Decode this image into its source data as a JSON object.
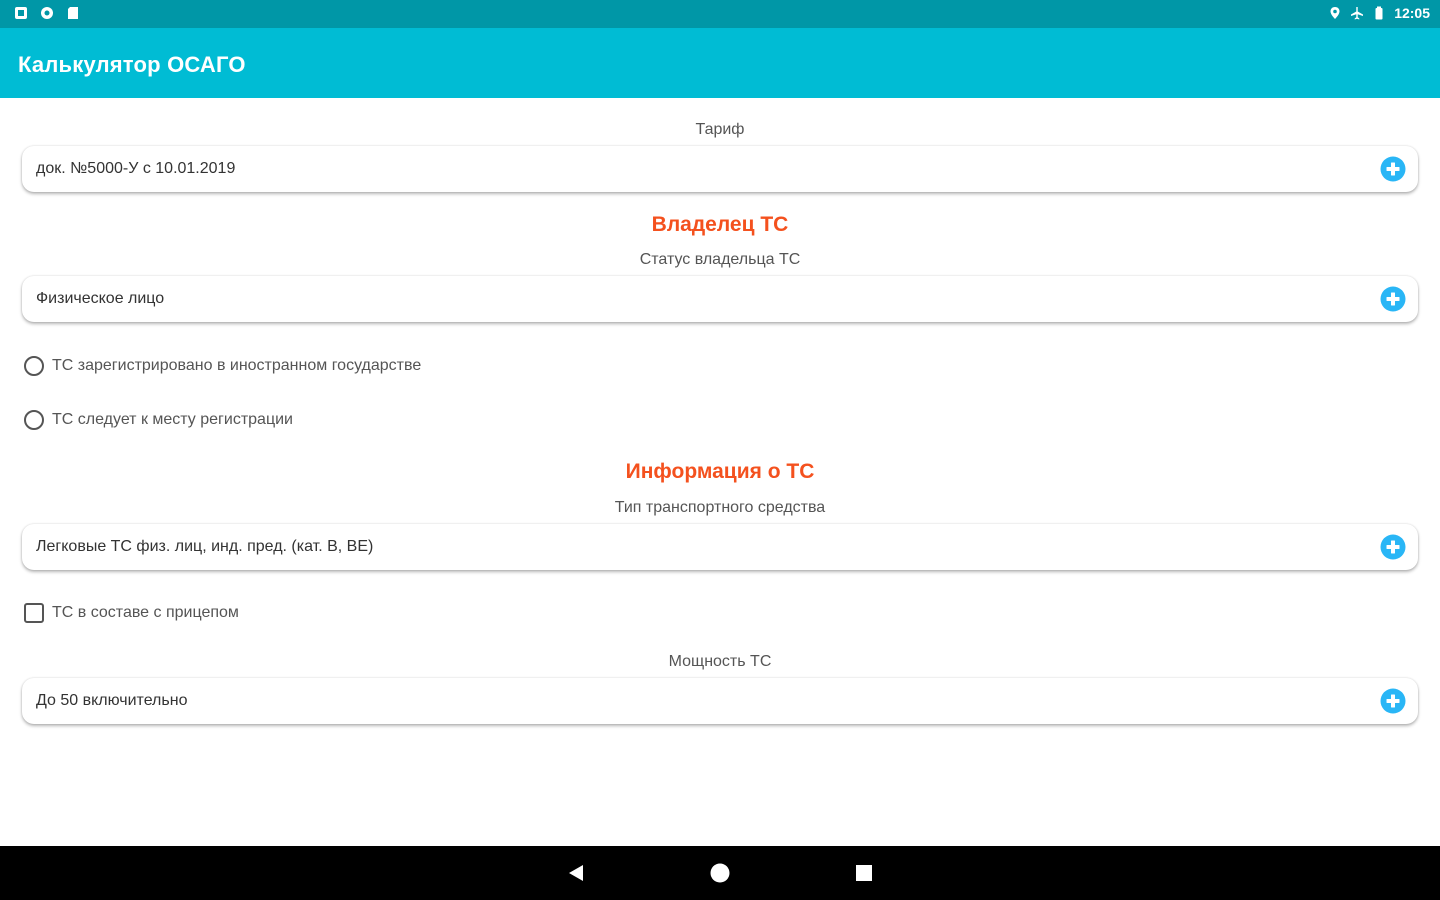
{
  "status_bar": {
    "left_icons": [
      "notification-icon",
      "settings-circle-icon",
      "sd-card-icon"
    ],
    "right_icons": [
      "location-icon",
      "airplane-icon",
      "battery-icon"
    ],
    "time": "12:05"
  },
  "app_bar": {
    "title": "Калькулятор ОСАГО"
  },
  "tariff": {
    "label": "Тариф",
    "value": "док. №5000-У с 10.01.2019"
  },
  "owner_section": {
    "title": "Владелец ТС",
    "status_label": "Статус владельца ТС",
    "status_value": "Физическое лицо",
    "option_foreign": "ТС зарегистрировано в иностранном государстве",
    "option_to_registration": "ТС следует к месту регистрации"
  },
  "vehicle_section": {
    "title": "Информация о ТС",
    "type_label": "Тип транспортного средства",
    "type_value": "Легковые ТС физ. лиц, инд. пред. (кат. B, BE)",
    "trailer_checkbox": "ТС в составе с прицепом",
    "power_label": "Мощность ТС",
    "power_value": "До 50 включительно"
  },
  "colors": {
    "status_bar": "#0097a7",
    "app_bar": "#00bcd4",
    "section_title": "#f4511e",
    "add_icon": "#29b6f6"
  }
}
